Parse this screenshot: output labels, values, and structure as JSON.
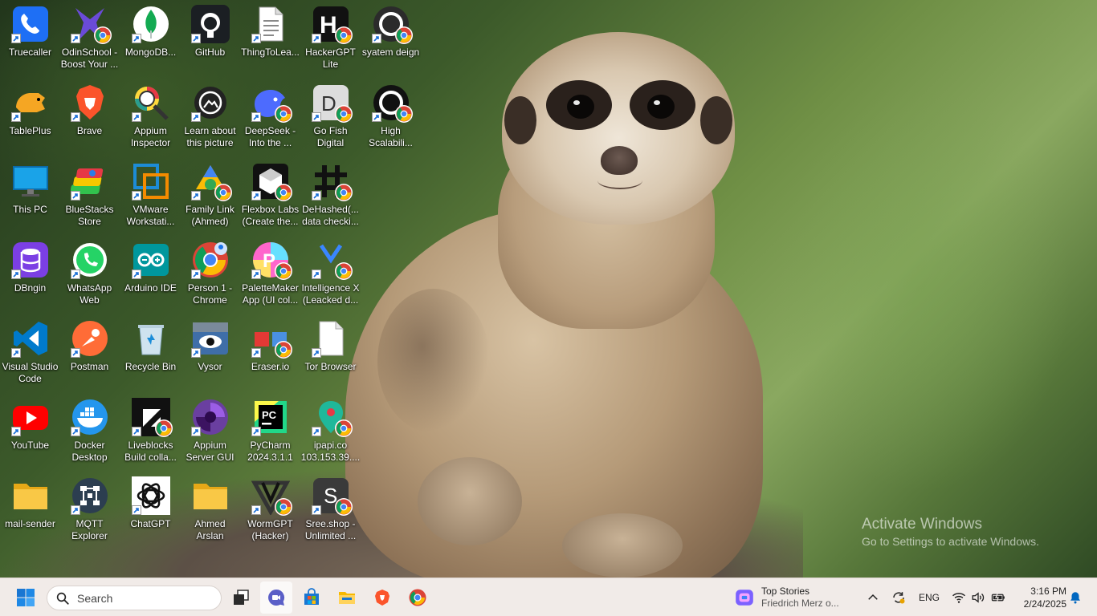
{
  "desktop": {
    "icons": [
      {
        "label": "Truecaller",
        "icon": "truecaller-icon",
        "color": "#1e6ff5",
        "chrome": false
      },
      {
        "label": "OdinSchool -\nBoost Your ...",
        "icon": "odinschool-icon",
        "color": "#6a4bd8",
        "chrome": true
      },
      {
        "label": "MongoDB...",
        "icon": "mongodb-icon",
        "color": "#13aa52",
        "chrome": false
      },
      {
        "label": "GitHub",
        "icon": "github-icon",
        "color": "#1b1f23",
        "chrome": false
      },
      {
        "label": "ThingToLea...",
        "icon": "text-file-icon",
        "color": "#f2f2f2",
        "chrome": false
      },
      {
        "label": "HackerGPT\nLite",
        "icon": "hackergpt-icon",
        "color": "#111111",
        "chrome": true
      },
      {
        "label": "syatem deign",
        "icon": "system-design-icon",
        "color": "#2b2b2b",
        "chrome": true
      },
      {
        "label": "TablePlus",
        "icon": "tableplus-icon",
        "color": "#f5a623",
        "chrome": false
      },
      {
        "label": "Brave",
        "icon": "brave-icon",
        "color": "#fb542b",
        "chrome": false
      },
      {
        "label": "Appium\nInspector",
        "icon": "appium-inspector-icon",
        "color": "#7b3fa0",
        "chrome": false
      },
      {
        "label": "Learn about\nthis picture",
        "icon": "learn-picture-icon",
        "color": "#222222",
        "chrome": false
      },
      {
        "label": "DeepSeek -\nInto the ...",
        "icon": "deepseek-icon",
        "color": "#4d6bfe",
        "chrome": true
      },
      {
        "label": "Go Fish\nDigital",
        "icon": "gofish-icon",
        "color": "#333333",
        "chrome": true
      },
      {
        "label": "High\nScalabili...",
        "icon": "high-scalability-icon",
        "color": "#111111",
        "chrome": true
      },
      {
        "label": "This PC",
        "icon": "this-pc-icon",
        "color": "#1aa3e8",
        "chrome": false
      },
      {
        "label": "BlueStacks\nStore",
        "icon": "bluestacks-icon",
        "color": "#32c24d",
        "chrome": false
      },
      {
        "label": "VMware\nWorkstati...",
        "icon": "vmware-icon",
        "color": "#1d8cd6",
        "chrome": false
      },
      {
        "label": "Family Link\n(Ahmed)",
        "icon": "family-link-icon",
        "color": "#4285f4",
        "chrome": true
      },
      {
        "label": "Flexbox Labs\n(Create the...",
        "icon": "flexbox-labs-icon",
        "color": "#111111",
        "chrome": true
      },
      {
        "label": "DeHashed(...\ndata checki...",
        "icon": "dehashed-icon",
        "color": "#111111",
        "chrome": true
      },
      {
        "label": "DBngin",
        "icon": "dbngin-icon",
        "color": "#7b3fe4",
        "chrome": false
      },
      {
        "label": "WhatsApp\nWeb",
        "icon": "whatsapp-icon",
        "color": "#25d366",
        "chrome": false
      },
      {
        "label": "Arduino IDE",
        "icon": "arduino-icon",
        "color": "#00979d",
        "chrome": false
      },
      {
        "label": "Person 1 -\nChrome",
        "icon": "chrome-profile-icon",
        "color": "#4285f4",
        "chrome": false
      },
      {
        "label": "PaletteMaker\nApp (UI col...",
        "icon": "palettemaker-icon",
        "color": "#e83fd8",
        "chrome": true
      },
      {
        "label": "Intelligence X\n(Leacked d...",
        "icon": "intelligence-x-icon",
        "color": "#3a86ff",
        "chrome": true
      },
      {
        "label": "Visual Studio\nCode",
        "icon": "vscode-icon",
        "color": "#007acc",
        "chrome": false
      },
      {
        "label": "Postman",
        "icon": "postman-icon",
        "color": "#ff6c37",
        "chrome": false
      },
      {
        "label": "Recycle Bin",
        "icon": "recycle-bin-icon",
        "color": "#cfe3ef",
        "chrome": false
      },
      {
        "label": "Vysor",
        "icon": "vysor-icon",
        "color": "#3f6ea8",
        "chrome": false
      },
      {
        "label": "Eraser.io",
        "icon": "eraser-icon",
        "color": "#e53935",
        "chrome": true
      },
      {
        "label": "Tor Browser",
        "icon": "blank-file-icon",
        "color": "#ffffff",
        "chrome": false
      },
      {
        "label": "YouTube",
        "icon": "youtube-icon",
        "color": "#ff0000",
        "chrome": false
      },
      {
        "label": "Docker\nDesktop",
        "icon": "docker-icon",
        "color": "#2496ed",
        "chrome": false
      },
      {
        "label": "Liveblocks\nBuild colla...",
        "icon": "liveblocks-icon",
        "color": "#111111",
        "chrome": true
      },
      {
        "label": "Appium\nServer GUI",
        "icon": "appium-server-icon",
        "color": "#6a3fa0",
        "chrome": false
      },
      {
        "label": "PyCharm\n2024.3.1.1",
        "icon": "pycharm-icon",
        "color": "#21d789",
        "chrome": false
      },
      {
        "label": "ipapi.co\n103.153.39....",
        "icon": "ipapi-icon",
        "color": "#1fb89a",
        "chrome": true
      },
      {
        "label": "mail-sender",
        "icon": "folder-icon",
        "color": "#f9c846",
        "chrome": false
      },
      {
        "label": "MQTT\nExplorer",
        "icon": "mqtt-explorer-icon",
        "color": "#2c3e50",
        "chrome": false
      },
      {
        "label": "ChatGPT",
        "icon": "chatgpt-icon",
        "color": "#ffffff",
        "chrome": false
      },
      {
        "label": "Ahmed\nArslan",
        "icon": "folder-icon",
        "color": "#f9c846",
        "chrome": false
      },
      {
        "label": "WormGPT\n(Hacker)",
        "icon": "wormgpt-icon",
        "color": "#333333",
        "chrome": true
      },
      {
        "label": "Sree.shop -\nUnlimited ...",
        "icon": "sree-shop-icon",
        "color": "#3a3a3a",
        "chrome": true
      }
    ]
  },
  "watermark": {
    "title": "Activate Windows",
    "subtitle": "Go to Settings to activate Windows."
  },
  "taskbar": {
    "search_placeholder": "Search",
    "apps": [
      {
        "name": "task-view",
        "icon": "task-view-icon"
      },
      {
        "name": "meet",
        "icon": "meet-chat-icon"
      },
      {
        "name": "store",
        "icon": "microsoft-store-icon"
      },
      {
        "name": "file-explorer",
        "icon": "file-explorer-icon"
      },
      {
        "name": "brave",
        "icon": "brave-icon"
      },
      {
        "name": "chrome",
        "icon": "chrome-icon"
      }
    ],
    "news": {
      "title": "Top Stories",
      "subtitle": "Friedrich Merz o..."
    },
    "tray": {
      "language": "ENG",
      "time": "3:16 PM",
      "date": "2/24/2025"
    }
  },
  "colors": {
    "taskbar_bg": "#f1ebe8",
    "accent": "#0067c0",
    "label_text": "#ffffff"
  }
}
